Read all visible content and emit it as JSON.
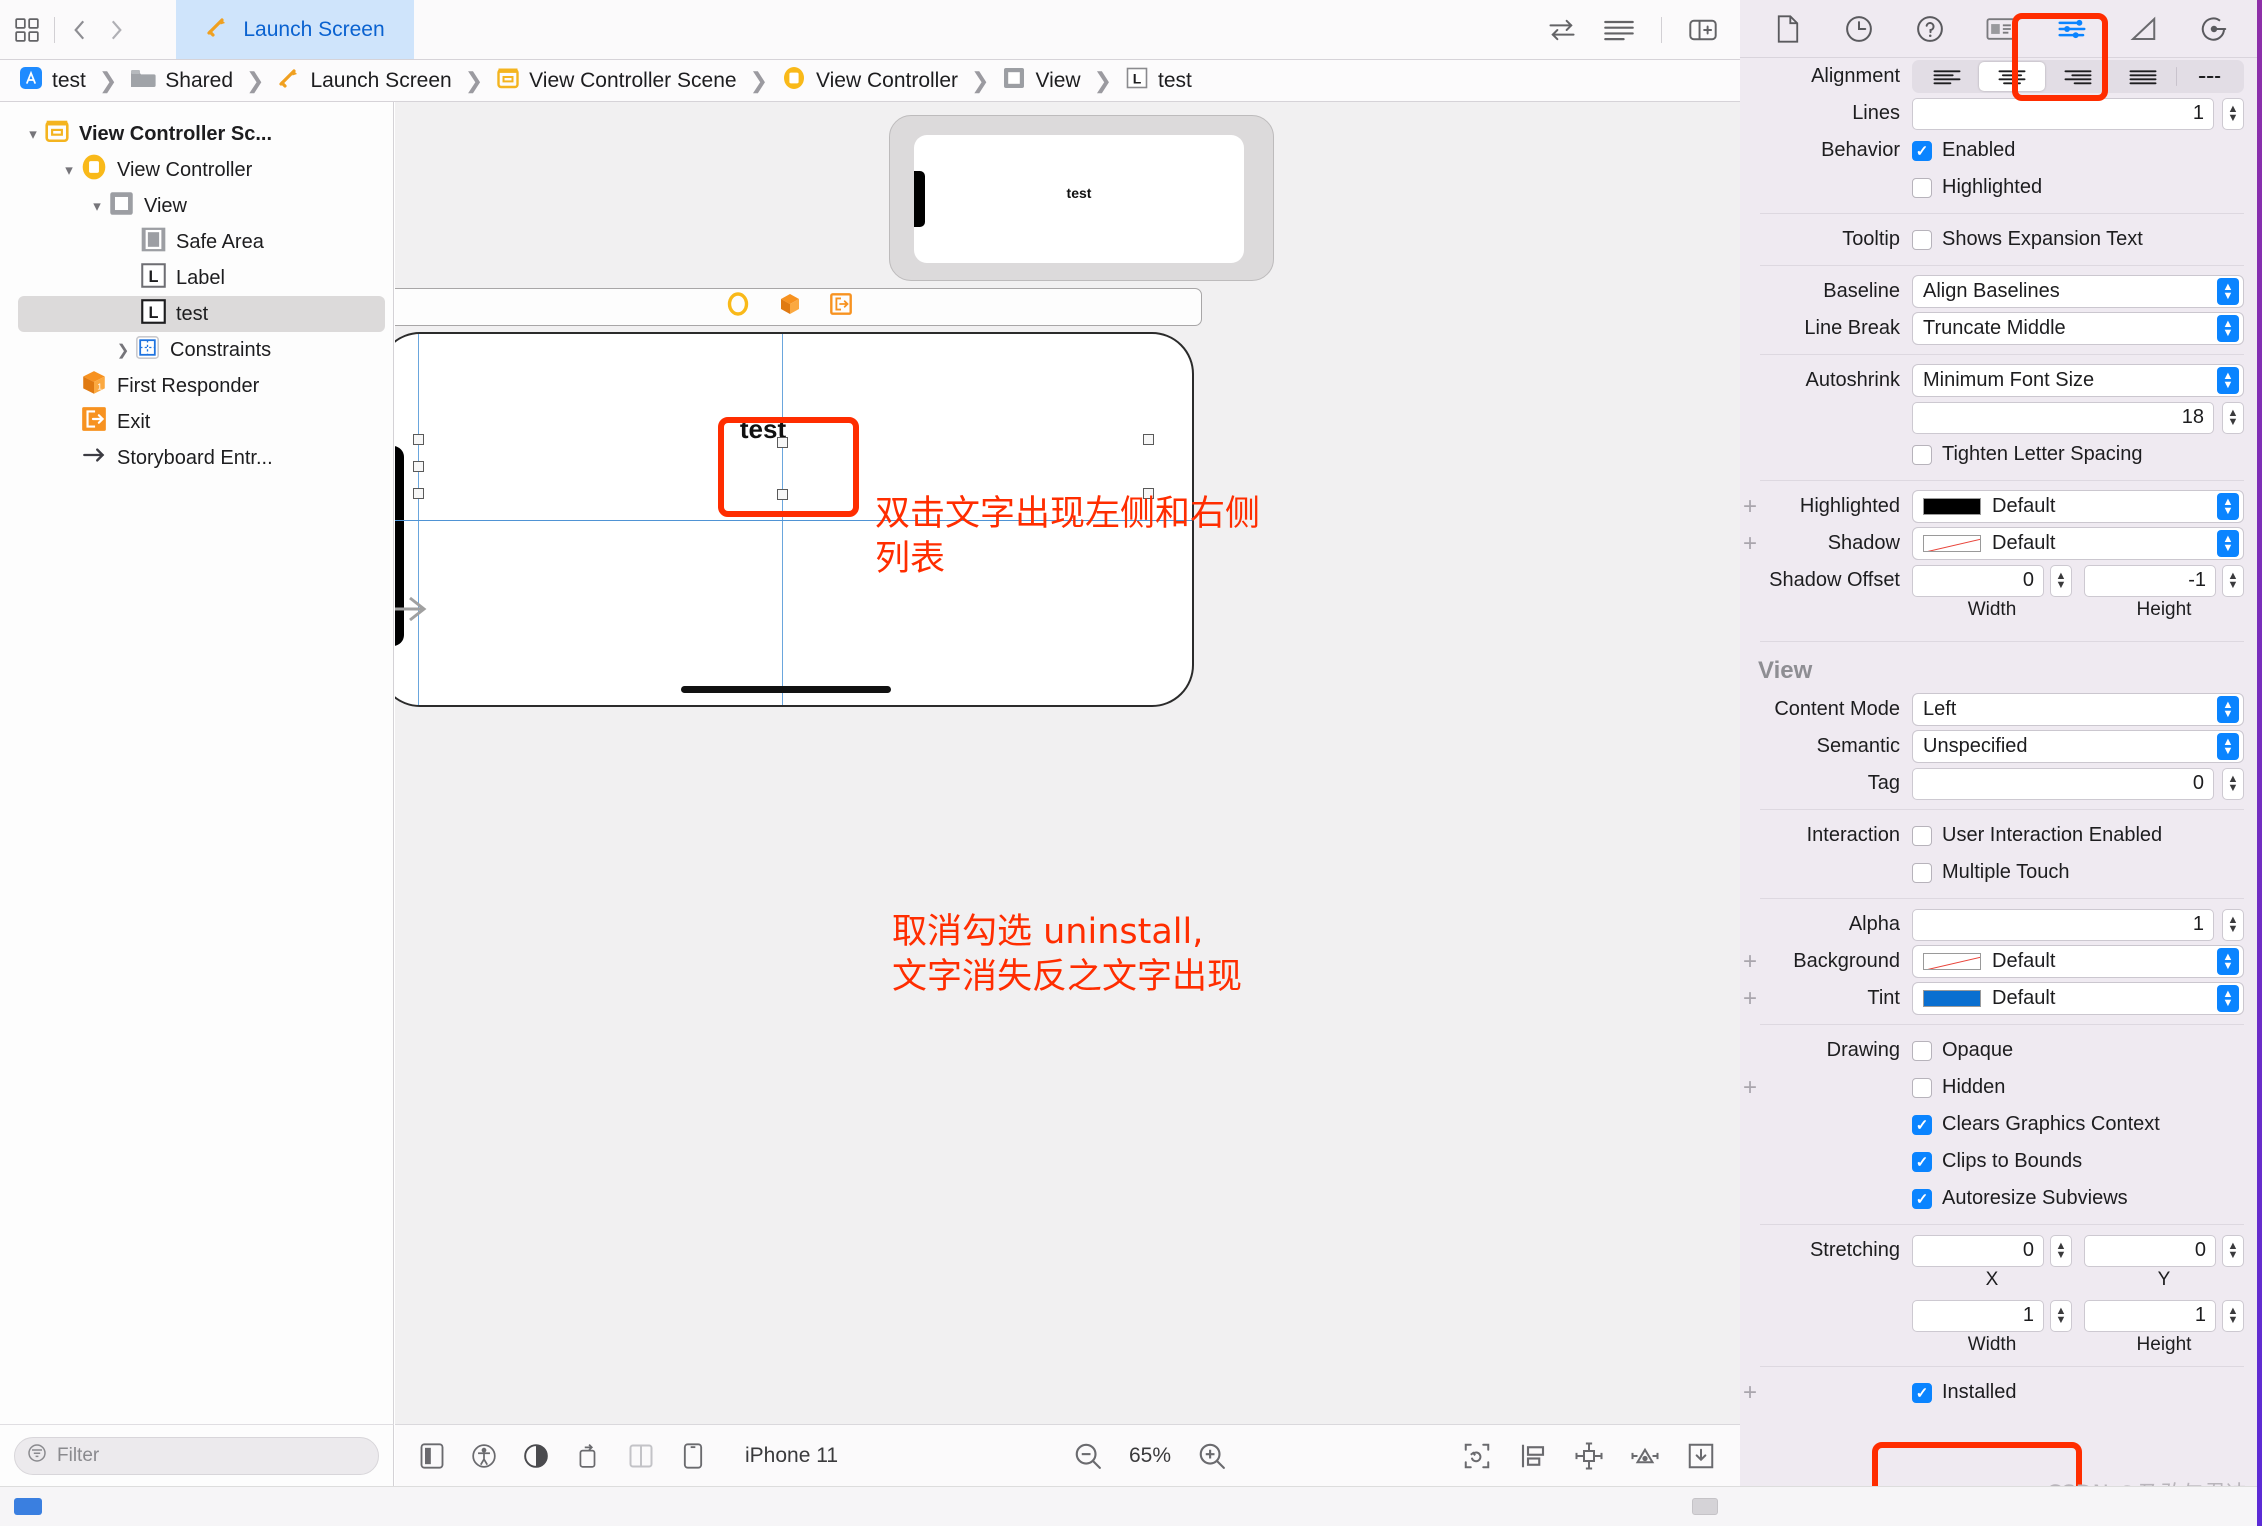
{
  "window": {
    "tab": {
      "label": "Launch Screen",
      "icon": "storyboard-icon"
    },
    "toolbar_right": [
      "swap-arrows-icon",
      "lines-icon",
      "panel-toggle-icon"
    ]
  },
  "breadcrumb": [
    {
      "label": "test",
      "icon": "app-project-icon"
    },
    {
      "label": "Shared",
      "icon": "folder-icon"
    },
    {
      "label": "Launch Screen",
      "icon": "storyboard-icon"
    },
    {
      "label": "View Controller Scene",
      "icon": "scene-icon"
    },
    {
      "label": "View Controller",
      "icon": "view-controller-icon"
    },
    {
      "label": "View",
      "icon": "view-icon"
    },
    {
      "label": "test",
      "icon": "label-icon"
    }
  ],
  "outline": {
    "items": [
      {
        "label": "View Controller Sc...",
        "icon": "scene-icon",
        "indent": 0,
        "twisty": "down",
        "bold": true,
        "selected": false
      },
      {
        "label": "View Controller",
        "icon": "view-controller-icon",
        "indent": 1,
        "twisty": "down",
        "bold": false,
        "selected": false
      },
      {
        "label": "View",
        "icon": "view-icon",
        "indent": 2,
        "twisty": "down",
        "bold": false,
        "selected": false
      },
      {
        "label": "Safe Area",
        "icon": "safe-area-icon",
        "indent": 3,
        "twisty": "",
        "bold": false,
        "selected": false
      },
      {
        "label": "Label",
        "icon": "label-icon",
        "indent": 3,
        "twisty": "",
        "bold": false,
        "selected": false
      },
      {
        "label": "test",
        "icon": "label-icon",
        "indent": 3,
        "twisty": "",
        "bold": false,
        "selected": true
      },
      {
        "label": "Constraints",
        "icon": "constraints-icon",
        "indent": 2,
        "twisty": "right",
        "bold": false,
        "selected": false
      },
      {
        "label": "First Responder",
        "icon": "first-responder-icon",
        "indent": 1,
        "twisty": "",
        "bold": false,
        "selected": false
      },
      {
        "label": "Exit",
        "icon": "exit-icon",
        "indent": 1,
        "twisty": "",
        "bold": false,
        "selected": false
      },
      {
        "label": "Storyboard Entr...",
        "icon": "entry-arrow-icon",
        "indent": 1,
        "twisty": "",
        "bold": false,
        "selected": false
      }
    ],
    "filter_placeholder": "Filter"
  },
  "canvas": {
    "mini_preview_label": "test",
    "dock_icons": [
      "view-controller-icon",
      "first-responder-icon",
      "exit-icon"
    ],
    "label_text": "test",
    "annotation_1": "双击文字出现左侧和右侧\n列表",
    "annotation_2": "取消勾选 uninstall,\n文字消失反之文字出现"
  },
  "canvas_bar": {
    "left_icons": [
      "device-orientation-icon",
      "accessibility-icon",
      "appearance-icon",
      "rotate-device-icon",
      "split-view-icon",
      "device-size-icon"
    ],
    "device_name": "iPhone 11",
    "zoom_out_icon": "zoom-out-icon",
    "zoom_level": "65%",
    "zoom_in_icon": "zoom-in-icon",
    "right_icons": [
      "update-frames-icon",
      "embed-in-icon",
      "align-icon",
      "resolve-issues-icon",
      "add-constraints-icon"
    ]
  },
  "inspector": {
    "tabs": [
      {
        "name": "file-inspector-icon",
        "active": false
      },
      {
        "name": "history-inspector-icon",
        "active": false
      },
      {
        "name": "quick-help-icon",
        "active": false
      },
      {
        "name": "identity-inspector-icon",
        "active": false
      },
      {
        "name": "attributes-inspector-icon",
        "active": true
      },
      {
        "name": "size-inspector-icon",
        "active": false
      },
      {
        "name": "connections-inspector-icon",
        "active": false
      }
    ],
    "label_section": {
      "alignment": {
        "label": "Alignment",
        "options": [
          "align-left",
          "align-center",
          "align-right",
          "align-justified",
          "align-natural"
        ],
        "selected_index": 1
      },
      "lines": {
        "label": "Lines",
        "value": "1"
      },
      "behavior": {
        "label": "Behavior",
        "enabled_label": "Enabled",
        "enabled": true,
        "highlighted_label": "Highlighted",
        "highlighted": false
      },
      "tooltip": {
        "label": "Tooltip",
        "shows_expansion_label": "Shows Expansion Text",
        "checked": false
      },
      "baseline": {
        "label": "Baseline",
        "value": "Align Baselines"
      },
      "line_break": {
        "label": "Line Break",
        "value": "Truncate Middle"
      },
      "autoshrink": {
        "label": "Autoshrink",
        "value": "Minimum Font Size",
        "min_size": "18",
        "tighten_label": "Tighten Letter Spacing",
        "tighten": false
      },
      "highlighted_color": {
        "label": "Highlighted",
        "value": "Default",
        "swatch": "#000000"
      },
      "shadow": {
        "label": "Shadow",
        "value": "Default",
        "swatch": "diagonal-red"
      },
      "shadow_offset": {
        "label": "Shadow Offset",
        "width": "0",
        "height": "-1",
        "width_caption": "Width",
        "height_caption": "Height"
      }
    },
    "view_section": {
      "title": "View",
      "content_mode": {
        "label": "Content Mode",
        "value": "Left"
      },
      "semantic": {
        "label": "Semantic",
        "value": "Unspecified"
      },
      "tag": {
        "label": "Tag",
        "value": "0"
      },
      "interaction": {
        "label": "Interaction",
        "user_interaction_label": "User Interaction Enabled",
        "user_interaction": false,
        "multiple_touch_label": "Multiple Touch",
        "multiple_touch": false
      },
      "alpha": {
        "label": "Alpha",
        "value": "1"
      },
      "background": {
        "label": "Background",
        "value": "Default",
        "swatch": "diagonal-red"
      },
      "tint": {
        "label": "Tint",
        "value": "Default",
        "swatch": "#0a6fd0"
      },
      "drawing": {
        "label": "Drawing",
        "opaque_label": "Opaque",
        "opaque": false,
        "hidden_label": "Hidden",
        "hidden": false,
        "clears_label": "Clears Graphics Context",
        "clears": true,
        "clips_label": "Clips to Bounds",
        "clips": true,
        "autoresize_label": "Autoresize Subviews",
        "autoresize": true
      },
      "stretching": {
        "label": "Stretching",
        "x": "0",
        "y": "0",
        "w": "1",
        "h": "1",
        "x_caption": "X",
        "y_caption": "Y",
        "w_caption": "Width",
        "h_caption": "Height"
      },
      "installed": {
        "label": "Installed",
        "checked": true
      }
    }
  },
  "watermark": "CSDN @乃敢与君决",
  "colors": {
    "accent_blue": "#0a84ff",
    "annotation_red": "#ff2d00",
    "tab_active_bg": "#cfe4fb",
    "inspector_bg": "#efeaf1"
  }
}
